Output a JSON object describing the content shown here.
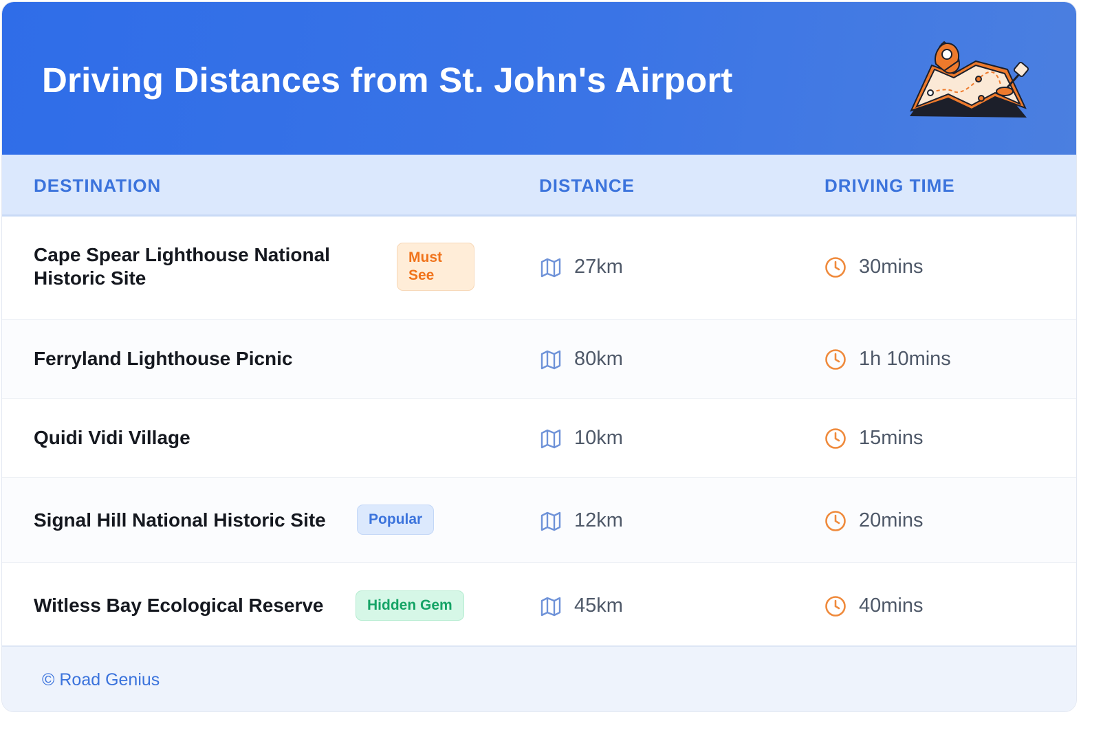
{
  "header": {
    "title": "Driving Distances from St. John's Airport",
    "illustration": "map-with-pins-illustration"
  },
  "columns": {
    "destination": "DESTINATION",
    "distance": "DISTANCE",
    "driving_time": "DRIVING TIME"
  },
  "rows": [
    {
      "destination": "Cape Spear Lighthouse National Historic Site",
      "badge": "Must See",
      "badge_color": "#f0731b",
      "distance": "27km",
      "time": "30mins"
    },
    {
      "destination": "Ferryland Lighthouse Picnic",
      "badge": "",
      "distance": "80km",
      "time": "1h 10mins"
    },
    {
      "destination": "Quidi Vidi Village",
      "badge": "",
      "distance": "10km",
      "time": "15mins"
    },
    {
      "destination": "Signal Hill National Historic Site",
      "badge": "Popular",
      "badge_color": "#3b73dc",
      "distance": "12km",
      "time": "20mins"
    },
    {
      "destination": "Witless Bay Ecological Reserve",
      "badge": "Hidden Gem",
      "badge_color": "#14a365",
      "distance": "45km",
      "time": "40mins"
    }
  ],
  "icons": {
    "distance": "map-icon",
    "time": "clock-icon"
  },
  "footer": {
    "text": "© Road Genius"
  },
  "colors": {
    "header_blue": "#2f6de8",
    "accent_blue": "#3b73dc",
    "clock_orange": "#ef8a3c",
    "map_icon_blue": "#6e92d8"
  }
}
